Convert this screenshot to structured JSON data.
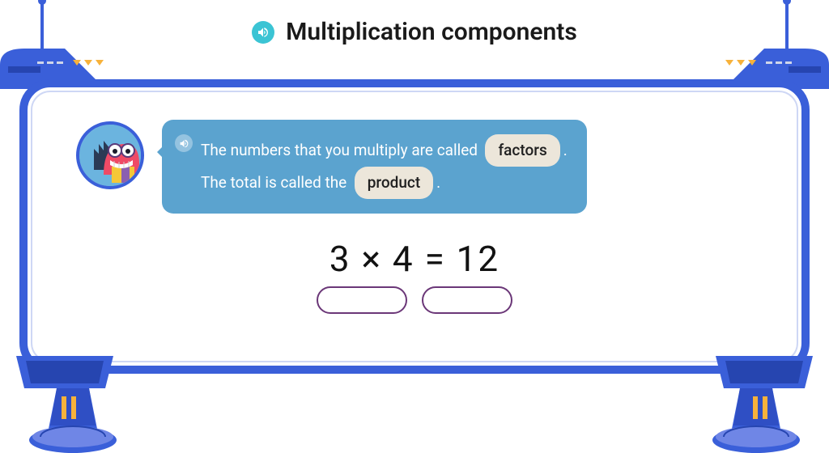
{
  "title": "Multiplication components",
  "bubble": {
    "line1_prefix": "The numbers that you multiply are called",
    "pill1": "factors",
    "line2_prefix": "The total is called the",
    "pill2": "product"
  },
  "equation": "3 × 4 = 12",
  "slots": {
    "count": 2
  }
}
